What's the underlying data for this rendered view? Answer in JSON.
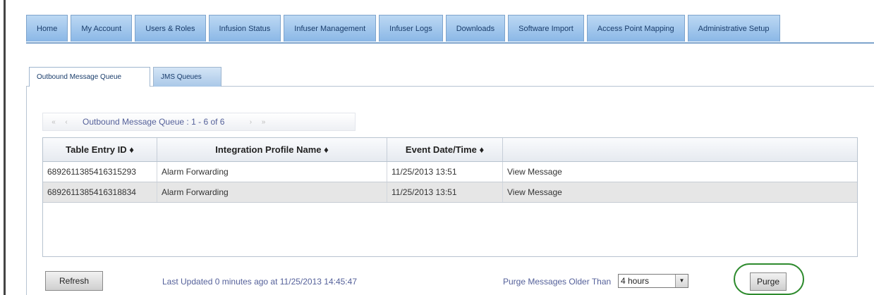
{
  "nav": {
    "tabs": [
      "Home",
      "My Account",
      "Users & Roles",
      "Infusion Status",
      "Infuser Management",
      "Infuser Logs",
      "Downloads",
      "Software Import",
      "Access Point Mapping",
      "Administrative Setup"
    ]
  },
  "subtabs": {
    "active": "Outbound Message Queue",
    "other": "JMS Queues"
  },
  "pager": {
    "first": "«",
    "prev": "‹",
    "text": "Outbound Message Queue : 1 - 6 of 6",
    "next": "›",
    "last": "»"
  },
  "table": {
    "headers": [
      "Table Entry ID ♦",
      "Integration Profile Name ♦",
      "Event Date/Time ♦",
      ""
    ],
    "rows": [
      [
        "6892611385416315293",
        "Alarm Forwarding",
        "11/25/2013 13:51",
        "View Message"
      ],
      [
        "6892611385416318834",
        "Alarm Forwarding",
        "11/25/2013 13:51",
        "View Message"
      ]
    ]
  },
  "footer": {
    "refresh_label": "Refresh",
    "last_updated": "Last Updated 0 minutes ago at 11/25/2013 14:45:47",
    "purge_label": "Purge Messages Older Than",
    "purge_select": "4 hours",
    "purge_button": "Purge"
  },
  "colors": {
    "tab_gradient_top": "#bcd8f3",
    "tab_gradient_bottom": "#8ab7e6",
    "highlight_ring": "#2e8b2e"
  }
}
